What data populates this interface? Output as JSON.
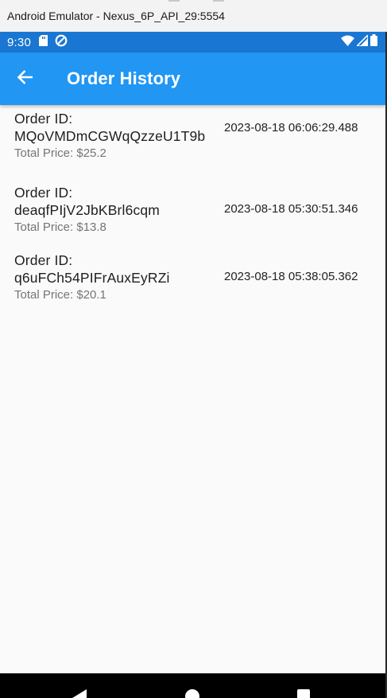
{
  "window": {
    "title": "Android Emulator - Nexus_6P_API_29:5554"
  },
  "status_bar": {
    "time": "9:30",
    "icons": [
      "sd-card-icon",
      "sync-icon",
      "wifi-icon",
      "cell-signal-icon",
      "battery-icon"
    ]
  },
  "app_bar": {
    "title": "Order History",
    "back_icon": "arrow-back-icon"
  },
  "orders": [
    {
      "id_label": "Order ID:",
      "id": "MQoVMDmCGWqQzzeU1T9b",
      "price": "Total Price: $25.2",
      "date": "2023-08-18 06:06:29.488"
    },
    {
      "id_label": "Order ID:",
      "id": "deaqfPIjV2JbKBrl6cqm",
      "price": "Total Price: $13.8",
      "date": "2023-08-18 05:30:51.346"
    },
    {
      "id_label": "Order ID:",
      "id": "q6uFCh54PIFrAuxEyRZi",
      "price": "Total Price: $20.1",
      "date": "2023-08-18 05:38:05.362"
    }
  ],
  "nav_bar": {
    "icons": [
      "nav-back-icon",
      "nav-home-icon",
      "nav-recents-icon"
    ]
  },
  "colors": {
    "status_bar": "#1976d2",
    "app_bar": "#2196f3",
    "background": "#fafafa",
    "secondary_text": "#757575"
  }
}
